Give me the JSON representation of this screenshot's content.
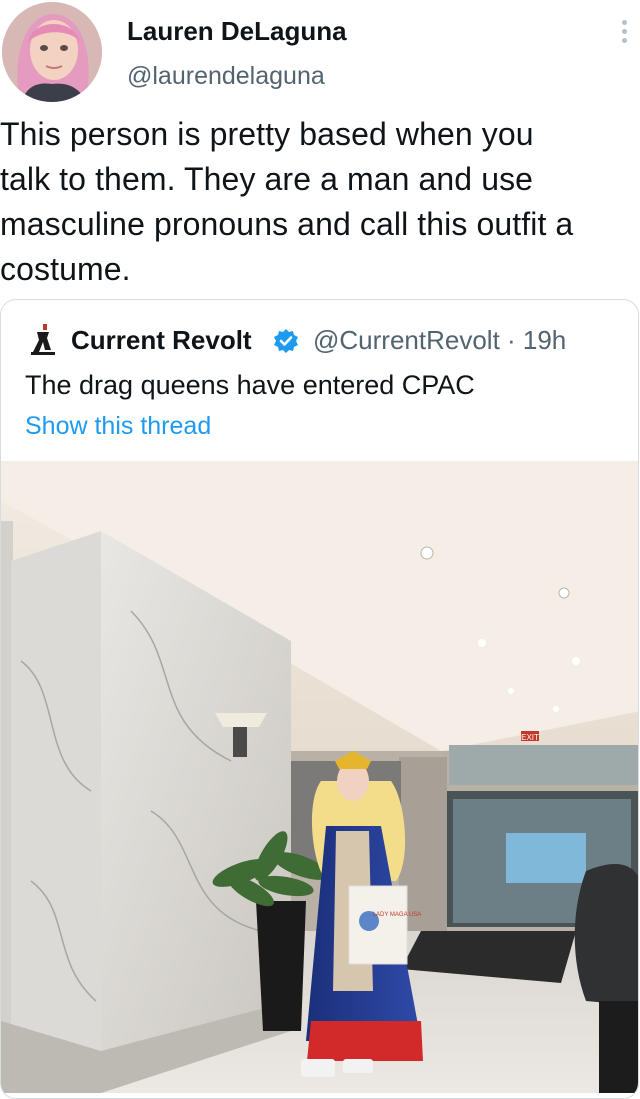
{
  "author": {
    "name": "Lauren DeLaguna",
    "handle": "@laurendelaguna",
    "avatar_icon": "profile-photo"
  },
  "tweet": {
    "lines": [
      "This person is pretty based when you",
      "talk to them. They are a man and use",
      "masculine pronouns and call this outfit a",
      "costume."
    ]
  },
  "quoted": {
    "name": "Current Revolt",
    "handle_time": "@CurrentRevolt · 19h",
    "text": "The drag queens have entered CPAC",
    "show_thread": "Show this thread",
    "logo_icon": "current-revolt-logo",
    "verified_icon": "verified-badge-icon",
    "photo": {
      "exit_sign": "EXIT",
      "bag_text": "LADY MAGA USA"
    }
  },
  "colors": {
    "text": "#0f1419",
    "muted": "#536471",
    "link": "#1d9bf0",
    "verified": "#1d9bf0"
  }
}
